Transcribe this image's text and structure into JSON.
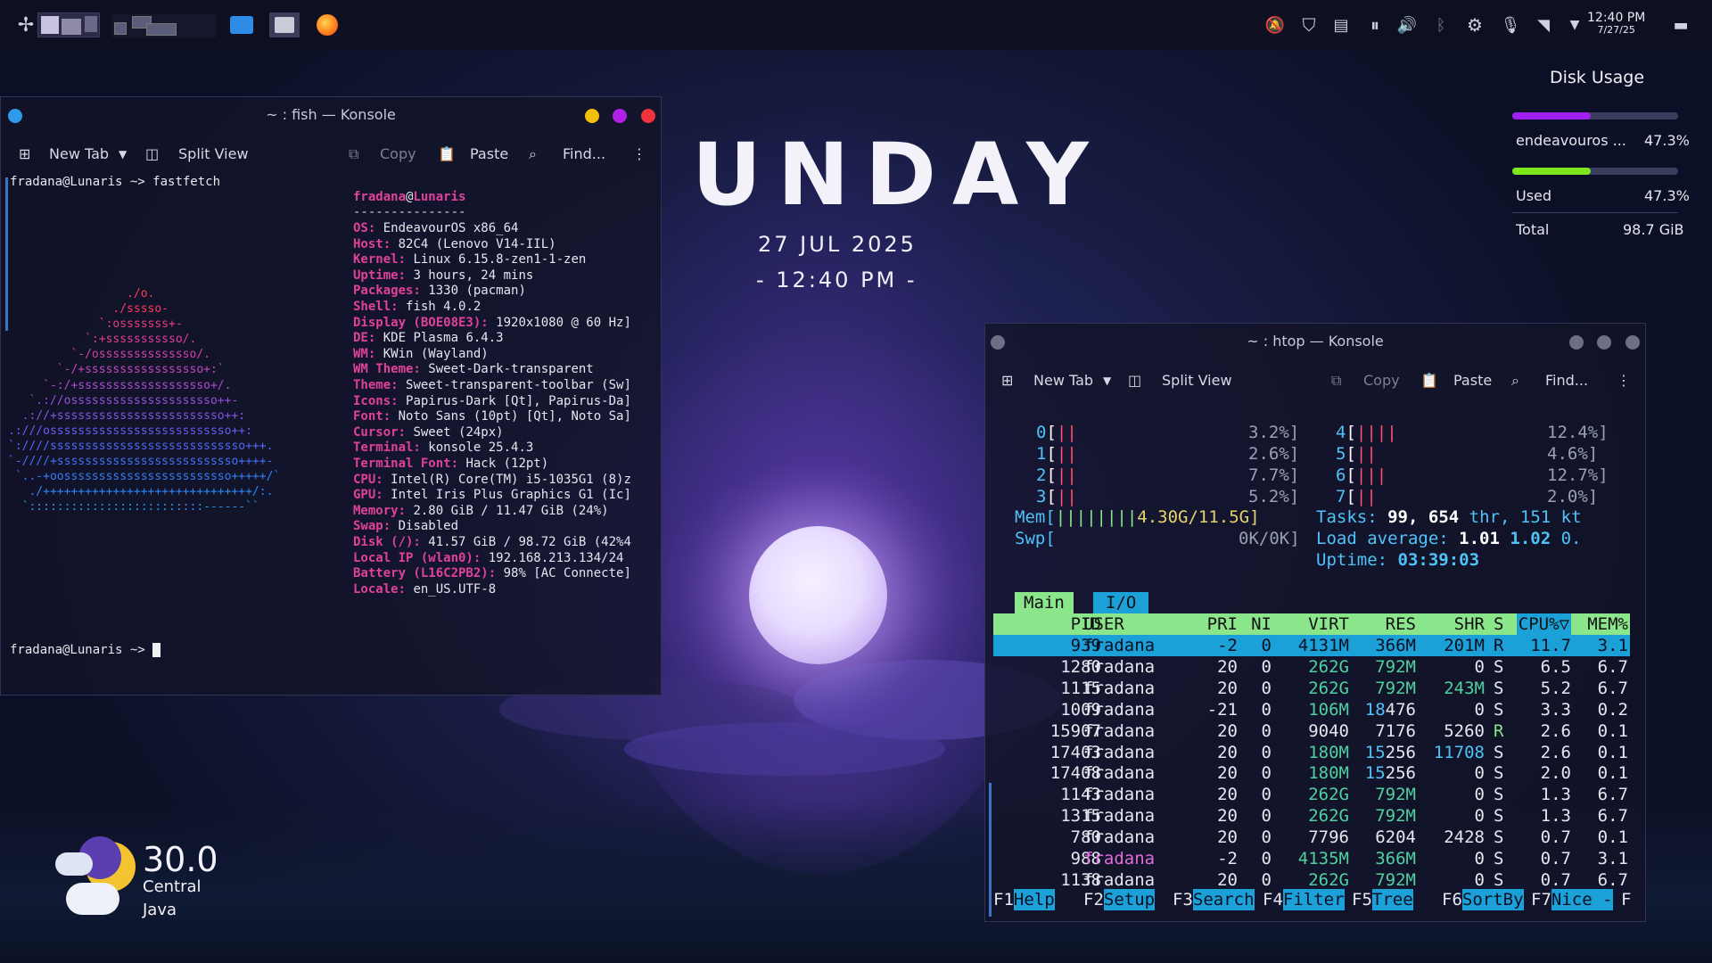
{
  "panel": {
    "clock_time": "12:40 PM",
    "clock_date": "7/27/25"
  },
  "wallpaper": {
    "word": "UNDAY",
    "date": "27 JUL 2025",
    "time": "- 12:40 PM -"
  },
  "konsole1": {
    "title": "~ : fish — Konsole",
    "new_tab": "New Tab",
    "split_view": "Split View",
    "copy": "Copy",
    "paste": "Paste",
    "find": "Find...",
    "prompt_user": "fradana@Lunaris",
    "prompt_cmd": "~> fastfetch",
    "prompt2": "~>",
    "ff_user": "fradana",
    "ff_at": "@",
    "ff_host": "Lunaris",
    "ff_sep": "---------------",
    "ff_lines": [
      [
        "OS:",
        "EndeavourOS x86_64"
      ],
      [
        "Host:",
        "82C4 (Lenovo V14-IIL)"
      ],
      [
        "Kernel:",
        "Linux 6.15.8-zen1-1-zen"
      ],
      [
        "Uptime:",
        "3 hours, 24 mins"
      ],
      [
        "Packages:",
        "1330 (pacman)"
      ],
      [
        "Shell:",
        "fish 4.0.2"
      ],
      [
        "Display (BOE08E3):",
        "1920x1080 @ 60 Hz]"
      ],
      [
        "DE:",
        "KDE Plasma 6.4.3"
      ],
      [
        "WM:",
        "KWin (Wayland)"
      ],
      [
        "WM Theme:",
        "Sweet-Dark-transparent"
      ],
      [
        "Theme:",
        "Sweet-transparent-toolbar (Sw]"
      ],
      [
        "Icons:",
        "Papirus-Dark [Qt], Papirus-Da]"
      ],
      [
        "Font:",
        "Noto Sans (10pt) [Qt], Noto Sa]"
      ],
      [
        "Cursor:",
        "Sweet (24px)"
      ],
      [
        "Terminal:",
        "konsole 25.4.3"
      ],
      [
        "Terminal Font:",
        "Hack (12pt)"
      ],
      [
        "CPU:",
        "Intel(R) Core(TM) i5-1035G1 (8)z"
      ],
      [
        "GPU:",
        "Intel Iris Plus Graphics G1 (Ic]"
      ],
      [
        "Memory:",
        "2.80 GiB / 11.47 GiB (24%)"
      ],
      [
        "Swap:",
        "Disabled"
      ],
      [
        "Disk (/):",
        "41.57 GiB / 98.72 GiB (42%4"
      ],
      [
        "Local IP (wlan0):",
        "192.168.213.134/24"
      ],
      [
        "Battery (L16C2PB2):",
        "98% [AC Connecte]"
      ],
      [
        "Locale:",
        "en_US.UTF-8"
      ]
    ],
    "logo_lines": [
      "                 ./o.",
      "               ./sssso-",
      "             `:osssssss+-",
      "           `:+sssssssssso/.",
      "         `-/ossssssssssssso/.",
      "       `-/+sssssssssssssssso+:`",
      "     `-:/+sssssssssssssssssso+/.",
      "   `.://osssssssssssssssssssso++-",
      "  .://+ssssssssssssssssssssssso++:",
      ".:///ossssssssssssssssssssssssso++:",
      "`:////ssssssssssssssssssssssssssso+++.",
      "`-////+ssssssssssssssssssssssssso++++-",
      " `..-+oossssssssssssssssssssssso+++++/`",
      "   ./++++++++++++++++++++++++++++++/:.",
      "  `:::::::::::::::::::::::::------``"
    ],
    "swatch_colors": [
      "#5c6370",
      "#ff4f6a",
      "#7df0b0",
      "#ffd400",
      "#1e90ff",
      "#e040d0",
      "#19c6e8",
      "#ffffff"
    ]
  },
  "konsole2": {
    "title": "~ : htop — Konsole",
    "new_tab": "New Tab",
    "split_view": "Split View",
    "copy": "Copy",
    "paste": "Paste",
    "find": "Find...",
    "cpus": [
      {
        "id": "0",
        "bars": "||",
        "pct": "3.2%]"
      },
      {
        "id": "1",
        "bars": "||",
        "pct": "2.6%]"
      },
      {
        "id": "2",
        "bars": "||",
        "pct": "7.7%]"
      },
      {
        "id": "3",
        "bars": "||",
        "pct": "5.2%]"
      },
      {
        "id": "4",
        "bars": "||||",
        "pct": "12.4%]"
      },
      {
        "id": "5",
        "bars": "||",
        "pct": "4.6%]"
      },
      {
        "id": "6",
        "bars": "|||",
        "pct": "12.7%]"
      },
      {
        "id": "7",
        "bars": "||",
        "pct": "2.0%]"
      }
    ],
    "mem_label": "Mem[",
    "mem_bars": "||||||||",
    "mem_val": "4.30G/11.5G]",
    "swp_label": "Swp[",
    "swp_val": "0K/0K]",
    "tasks_label": "Tasks:",
    "tasks_n": "99,",
    "threads_n": "654",
    "thr_label": "thr,",
    "kt_n": "151",
    "kt_label": "kt",
    "load_label": "Load average:",
    "load1": "1.01",
    "load2": "1.02",
    "load3": "0.",
    "uptime_label": "Uptime:",
    "uptime": "03:39:03",
    "tab_main": "Main",
    "tab_io": "I/O",
    "headers": [
      "PID",
      "USER",
      "PRI",
      "NI",
      "VIRT",
      "RES",
      "SHR",
      "S",
      "CPU%▽",
      "MEM%"
    ],
    "rows": [
      {
        "pid": "939",
        "user": "fradana",
        "pri": "-2",
        "ni": "0",
        "virt": "4131M",
        "res": "366M",
        "shr": "201M",
        "s": "R",
        "cpu": "11.7",
        "mem": "3.1"
      },
      {
        "pid": "1280",
        "user": "fradana",
        "pri": "20",
        "ni": "0",
        "virt": "262G",
        "res": "792M",
        "shr": "0",
        "s": "S",
        "cpu": "6.5",
        "mem": "6.7"
      },
      {
        "pid": "1115",
        "user": "fradana",
        "pri": "20",
        "ni": "0",
        "virt": "262G",
        "res": "792M",
        "shr": "243M",
        "s": "S",
        "cpu": "5.2",
        "mem": "6.7"
      },
      {
        "pid": "1009",
        "user": "fradana",
        "pri": "-21",
        "ni": "0",
        "virt": "106M",
        "res": "18476",
        "shr": "0",
        "s": "S",
        "cpu": "3.3",
        "mem": "0.2"
      },
      {
        "pid": "15907",
        "user": "fradana",
        "pri": "20",
        "ni": "0",
        "virt": "9040",
        "res": "7176",
        "shr": "5260",
        "s": "R",
        "cpu": "2.6",
        "mem": "0.1"
      },
      {
        "pid": "17403",
        "user": "fradana",
        "pri": "20",
        "ni": "0",
        "virt": "180M",
        "res": "15256",
        "shr": "11708",
        "s": "S",
        "cpu": "2.6",
        "mem": "0.1"
      },
      {
        "pid": "17408",
        "user": "fradana",
        "pri": "20",
        "ni": "0",
        "virt": "180M",
        "res": "15256",
        "shr": "0",
        "s": "S",
        "cpu": "2.0",
        "mem": "0.1"
      },
      {
        "pid": "1143",
        "user": "fradana",
        "pri": "20",
        "ni": "0",
        "virt": "262G",
        "res": "792M",
        "shr": "0",
        "s": "S",
        "cpu": "1.3",
        "mem": "6.7"
      },
      {
        "pid": "1315",
        "user": "fradana",
        "pri": "20",
        "ni": "0",
        "virt": "262G",
        "res": "792M",
        "shr": "0",
        "s": "S",
        "cpu": "1.3",
        "mem": "6.7"
      },
      {
        "pid": "780",
        "user": "fradana",
        "pri": "20",
        "ni": "0",
        "virt": "7796",
        "res": "6204",
        "shr": "2428",
        "s": "S",
        "cpu": "0.7",
        "mem": "0.1"
      },
      {
        "pid": "988",
        "user": "fradana",
        "pri": "-2",
        "ni": "0",
        "virt": "4135M",
        "res": "366M",
        "shr": "0",
        "s": "S",
        "cpu": "0.7",
        "mem": "3.1"
      },
      {
        "pid": "1138",
        "user": "fradana",
        "pri": "20",
        "ni": "0",
        "virt": "262G",
        "res": "792M",
        "shr": "0",
        "s": "S",
        "cpu": "0.7",
        "mem": "6.7"
      }
    ],
    "fkeys": [
      [
        "F1",
        "Help"
      ],
      [
        "F2",
        "Setup"
      ],
      [
        "F3",
        "Search"
      ],
      [
        "F4",
        "Filter"
      ],
      [
        "F5",
        "Tree"
      ],
      [
        "F6",
        "SortBy"
      ],
      [
        "F7",
        "Nice -"
      ],
      [
        "F",
        ""
      ]
    ]
  },
  "disk": {
    "title": "Disk Usage",
    "name": "endeavouros ...",
    "name_pct": "47.3%",
    "used_label": "Used",
    "used_pct": "47.3%",
    "total_label": "Total",
    "total": "98.7 GiB",
    "fill": 0.473
  },
  "weather": {
    "temp": "30.0",
    "loc1": "Central",
    "loc2": "Java"
  },
  "colors": {
    "accent_purple": "#a020f0",
    "accent_green": "#7ee81e",
    "htop_header": "#8be58b",
    "htop_select": "#1ca0d8"
  }
}
